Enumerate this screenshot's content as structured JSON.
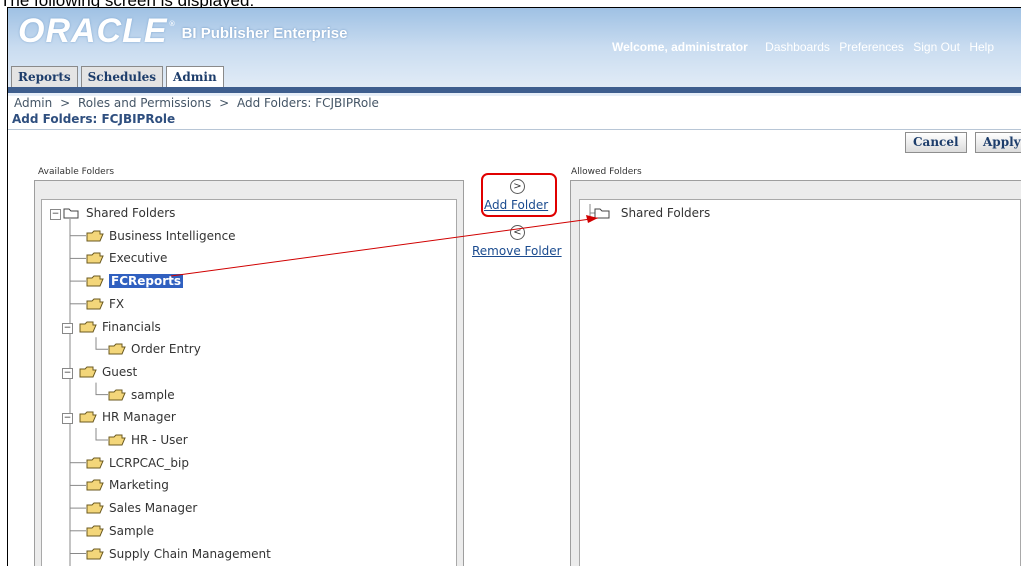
{
  "caption": "The following screen is displayed:",
  "header": {
    "logo_text": "ORACLE",
    "logo_mark": "®",
    "product": "BI Publisher Enterprise",
    "welcome": "Welcome, administrator",
    "links": [
      "Dashboards",
      "Preferences",
      "Sign Out",
      "Help"
    ]
  },
  "tabs": [
    {
      "label": "Reports",
      "active": false
    },
    {
      "label": "Schedules",
      "active": false
    },
    {
      "label": "Admin",
      "active": true
    }
  ],
  "breadcrumb": [
    "Admin",
    ">",
    "Roles and Permissions",
    ">",
    "Add Folders: FCJBIPRole"
  ],
  "page_title": "Add Folders: FCJBIPRole",
  "buttons": {
    "cancel": "Cancel",
    "apply": "Apply"
  },
  "available": {
    "label": "Available Folders",
    "root": "Shared Folders",
    "items": [
      {
        "label": "Business Intelligence",
        "level": 1,
        "expander": false,
        "last": false
      },
      {
        "label": "Executive",
        "level": 1,
        "expander": false,
        "last": false
      },
      {
        "label": "FCReports",
        "level": 1,
        "expander": false,
        "last": false,
        "selected": true
      },
      {
        "label": "FX",
        "level": 1,
        "expander": false,
        "last": false
      },
      {
        "label": "Financials",
        "level": 1,
        "expander": true,
        "last": false
      },
      {
        "label": "Order Entry",
        "level": 2,
        "expander": false,
        "last": true
      },
      {
        "label": "Guest",
        "level": 1,
        "expander": true,
        "last": false
      },
      {
        "label": "sample",
        "level": 2,
        "expander": false,
        "last": true
      },
      {
        "label": "HR Manager",
        "level": 1,
        "expander": true,
        "last": false
      },
      {
        "label": "HR - User",
        "level": 2,
        "expander": false,
        "last": true
      },
      {
        "label": "LCRPCAC_bip",
        "level": 1,
        "expander": false,
        "last": false
      },
      {
        "label": "Marketing",
        "level": 1,
        "expander": false,
        "last": false
      },
      {
        "label": "Sales Manager",
        "level": 1,
        "expander": false,
        "last": false
      },
      {
        "label": "Sample",
        "level": 1,
        "expander": false,
        "last": false
      },
      {
        "label": "Supply Chain Management",
        "level": 1,
        "expander": false,
        "last": false
      }
    ]
  },
  "middle": {
    "add_symbol": ">",
    "add_label": "Add Folder",
    "remove_symbol": "<",
    "remove_label": "Remove Folder"
  },
  "allowed": {
    "label": "Allowed Folders",
    "root": "Shared Folders"
  },
  "annotation_color": "#e00000"
}
